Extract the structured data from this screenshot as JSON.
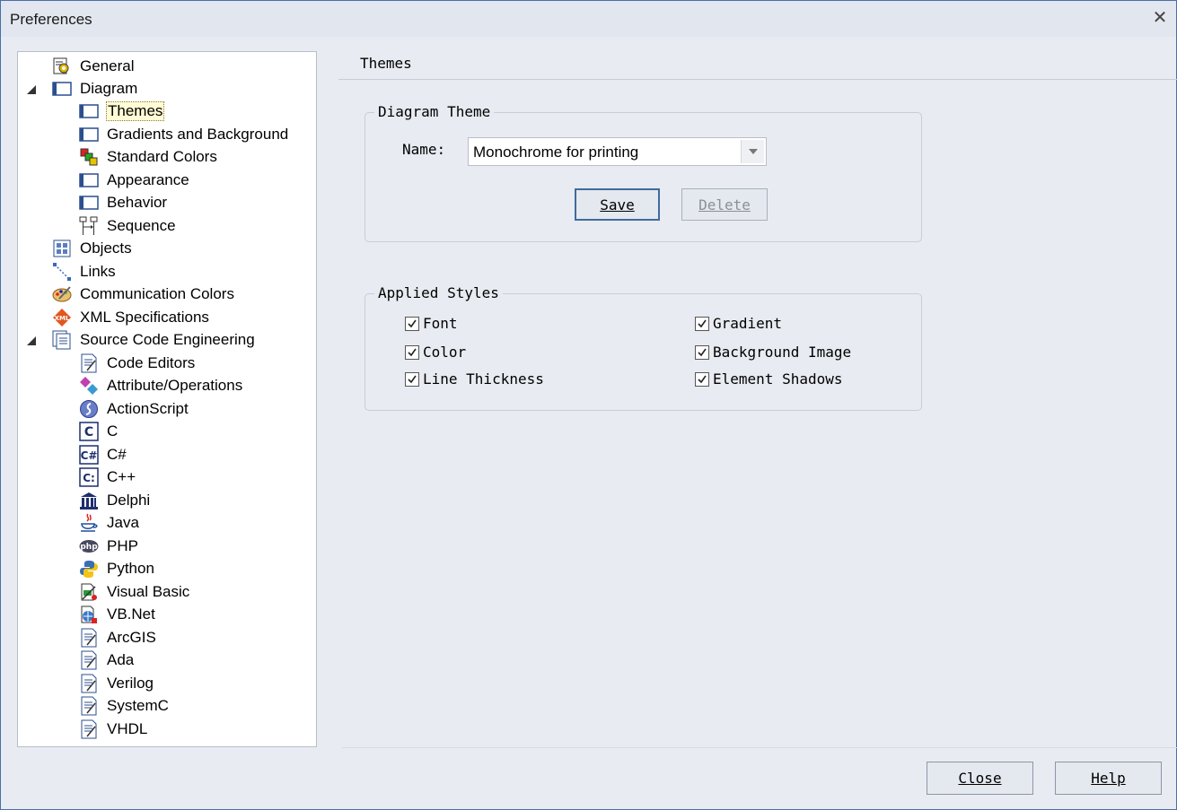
{
  "window": {
    "title": "Preferences"
  },
  "tree": {
    "items": [
      {
        "label": "General",
        "icon": "general-icon"
      },
      {
        "label": "Diagram",
        "icon": "diagram-icon"
      },
      {
        "label": "Themes",
        "icon": "diagram-page-icon"
      },
      {
        "label": "Gradients and Background",
        "icon": "diagram-page-icon"
      },
      {
        "label": "Standard Colors",
        "icon": "color-squares-icon"
      },
      {
        "label": "Appearance",
        "icon": "diagram-page-icon"
      },
      {
        "label": "Behavior",
        "icon": "diagram-page-icon"
      },
      {
        "label": "Sequence",
        "icon": "sequence-icon"
      },
      {
        "label": "Objects",
        "icon": "objects-icon"
      },
      {
        "label": "Links",
        "icon": "links-icon"
      },
      {
        "label": "Communication Colors",
        "icon": "palette-icon"
      },
      {
        "label": "XML Specifications",
        "icon": "xml-icon"
      },
      {
        "label": "Source Code Engineering",
        "icon": "source-code-icon"
      },
      {
        "label": "Code Editors",
        "icon": "code-file-icon"
      },
      {
        "label": "Attribute/Operations",
        "icon": "attribute-icon"
      },
      {
        "label": "ActionScript",
        "icon": "actionscript-icon"
      },
      {
        "label": "C",
        "icon": "c-icon"
      },
      {
        "label": "C#",
        "icon": "csharp-icon"
      },
      {
        "label": "C++",
        "icon": "cpp-icon"
      },
      {
        "label": "Delphi",
        "icon": "delphi-icon"
      },
      {
        "label": "Java",
        "icon": "java-icon"
      },
      {
        "label": "PHP",
        "icon": "php-icon"
      },
      {
        "label": "Python",
        "icon": "python-icon"
      },
      {
        "label": "Visual Basic",
        "icon": "visual-basic-icon"
      },
      {
        "label": "VB.Net",
        "icon": "vbnet-icon"
      },
      {
        "label": "ArcGIS",
        "icon": "code-file-icon"
      },
      {
        "label": "Ada",
        "icon": "code-file-icon"
      },
      {
        "label": "Verilog",
        "icon": "code-file-icon"
      },
      {
        "label": "SystemC",
        "icon": "code-file-icon"
      },
      {
        "label": "VHDL",
        "icon": "code-file-icon"
      }
    ],
    "selected": "Themes"
  },
  "panel": {
    "title": "Themes",
    "diagram_theme": {
      "legend": "Diagram Theme",
      "name_label": "Name:",
      "name_value": "Monochrome for printing",
      "save_label": "Save",
      "delete_label": "Delete"
    },
    "applied_styles": {
      "legend": "Applied Styles",
      "options": [
        {
          "label": "Font",
          "checked": true
        },
        {
          "label": "Color",
          "checked": true
        },
        {
          "label": "Line Thickness",
          "checked": true
        },
        {
          "label": "Gradient",
          "checked": true
        },
        {
          "label": "Background Image",
          "checked": true
        },
        {
          "label": "Element Shadows",
          "checked": true
        }
      ]
    }
  },
  "footer": {
    "close_label": "Close",
    "help_label": "Help"
  },
  "colors": {
    "accent": "#3f6b9e",
    "window_bg": "#e8ebf1",
    "tree_bg": "#ffffff"
  }
}
